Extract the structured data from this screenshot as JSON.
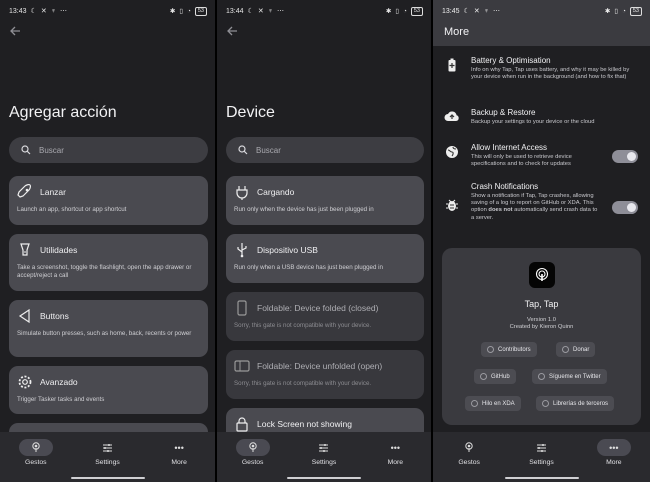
{
  "colors": {
    "background": "#1f1f22",
    "card": "#4a4a50",
    "card_disabled": "#38383d",
    "navbar": "#2a2a2e",
    "toggle_on": "#8e8e98"
  },
  "panel1": {
    "status": {
      "time": "13:43",
      "battery": "53"
    },
    "title": "Agregar acción",
    "search_placeholder": "Buscar",
    "cards": [
      {
        "name": "Lanzar",
        "desc": "Launch an app, shortcut or app shortcut",
        "icon": "rocket-icon"
      },
      {
        "name": "Utilidades",
        "desc": "Take a screenshot, toggle the flashlight, open the app drawer or accept/reject a call",
        "icon": "lamp-icon"
      },
      {
        "name": "Buttons",
        "desc": "Simulate button presses, such as home, back, recents or power",
        "icon": "triangle-back-icon"
      },
      {
        "name": "Avanzado",
        "desc": "Trigger Tasker tasks and events",
        "icon": "gear-icon"
      }
    ]
  },
  "panel2": {
    "status": {
      "time": "13:44",
      "battery": "53"
    },
    "title": "Device",
    "search_placeholder": "Buscar",
    "cards": [
      {
        "name": "Cargando",
        "desc": "Run only when the device has just been plugged in",
        "icon": "plug-icon"
      },
      {
        "name": "Dispositivo USB",
        "desc": "Run only when a USB device has just been plugged in",
        "icon": "usb-icon"
      },
      {
        "name": "Foldable: Device folded (closed)",
        "desc": "Sorry, this gate is not compatible with your device.",
        "icon": "phone-icon"
      },
      {
        "name": "Foldable: Device unfolded (open)",
        "desc": "Sorry, this gate is not compatible with your device.",
        "icon": "fold-icon"
      },
      {
        "name": "Lock Screen not showing",
        "icon": "lock-icon"
      }
    ]
  },
  "panel3": {
    "status": {
      "time": "13:45",
      "battery": "53"
    },
    "title": "More",
    "settings": [
      {
        "title": "Battery & Optimisation",
        "desc": "Info on why Tap, Tap uses battery, and why it may be killed by your device when run in the background (and how to fix that)"
      },
      {
        "title": "Backup & Restore",
        "desc": "Backup your settings to your device or the cloud"
      },
      {
        "title": "Allow Internet Access",
        "desc": "This will only be used to retrieve device specifications and to check for updates"
      },
      {
        "title": "Crash Notifications",
        "desc_a": "Show a notification if Tap, Tap crashes, allowing saving of a log to report on GitHub or XDA. This option ",
        "desc_b": "does not",
        "desc_c": " automatically send crash data to a server."
      }
    ],
    "about": {
      "app_name": "Tap, Tap",
      "version": "Version 1.0",
      "author": "Created by Kieron Quinn",
      "chips": [
        "Contributors",
        "Donar",
        "GitHub",
        "Sígueme en Twitter",
        "Hilo en XDA",
        "Librerías de terceros"
      ]
    }
  },
  "nav": {
    "gestos": "Gestos",
    "settings": "Settings",
    "more": "More"
  }
}
